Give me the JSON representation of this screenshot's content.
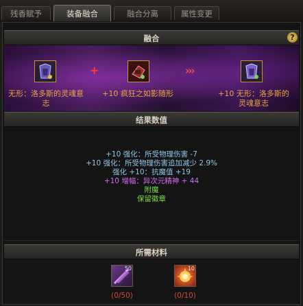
{
  "tabs": [
    {
      "label": "残香賦予"
    },
    {
      "label": "装备融合"
    },
    {
      "label": "融合分离"
    },
    {
      "label": "属性变更"
    }
  ],
  "fusion": {
    "header": "融合",
    "help_icon": "?",
    "source1": {
      "name": "无形：洛多斯的灵魂意志",
      "icon": "armor-set-icon"
    },
    "plus": "+",
    "source2": {
      "name": "+10 疯狂之如影随形",
      "icon": "weapon-icon"
    },
    "arrows": "›››",
    "result": {
      "name": "+10 无形：洛多斯的灵魂意志",
      "icon": "armor-set-icon"
    }
  },
  "results": {
    "header": "结果数值",
    "lines": [
      {
        "text": "+10 强化：所受物理伤害 -7",
        "color": "#8fc7e8"
      },
      {
        "text": "+10 强化：所受物理伤害追加减少 2.9%",
        "color": "#8fc7e8"
      },
      {
        "text": "强化 +10：抗魔值 +19",
        "color": "#8fc7e8"
      },
      {
        "text": "+10 增幅：异次元精神 + 44",
        "color": "#d36af0"
      },
      {
        "text": "附魔",
        "color": "#7ddc4a"
      },
      {
        "text": "保留徽章",
        "color": "#7ddc4a"
      }
    ]
  },
  "materials": {
    "header": "所需材料",
    "items": [
      {
        "count": "50",
        "requirement": "(0/50)",
        "icon": "feather-scroll-icon"
      },
      {
        "count": "10",
        "requirement": "(0/10)",
        "icon": "fire-crystal-icon"
      }
    ]
  },
  "colors": {
    "item_name": "#e6a640",
    "plus_sign": "#ff3a3a",
    "arrows": "#ff4a4a",
    "requirement": "#d24a3a"
  }
}
